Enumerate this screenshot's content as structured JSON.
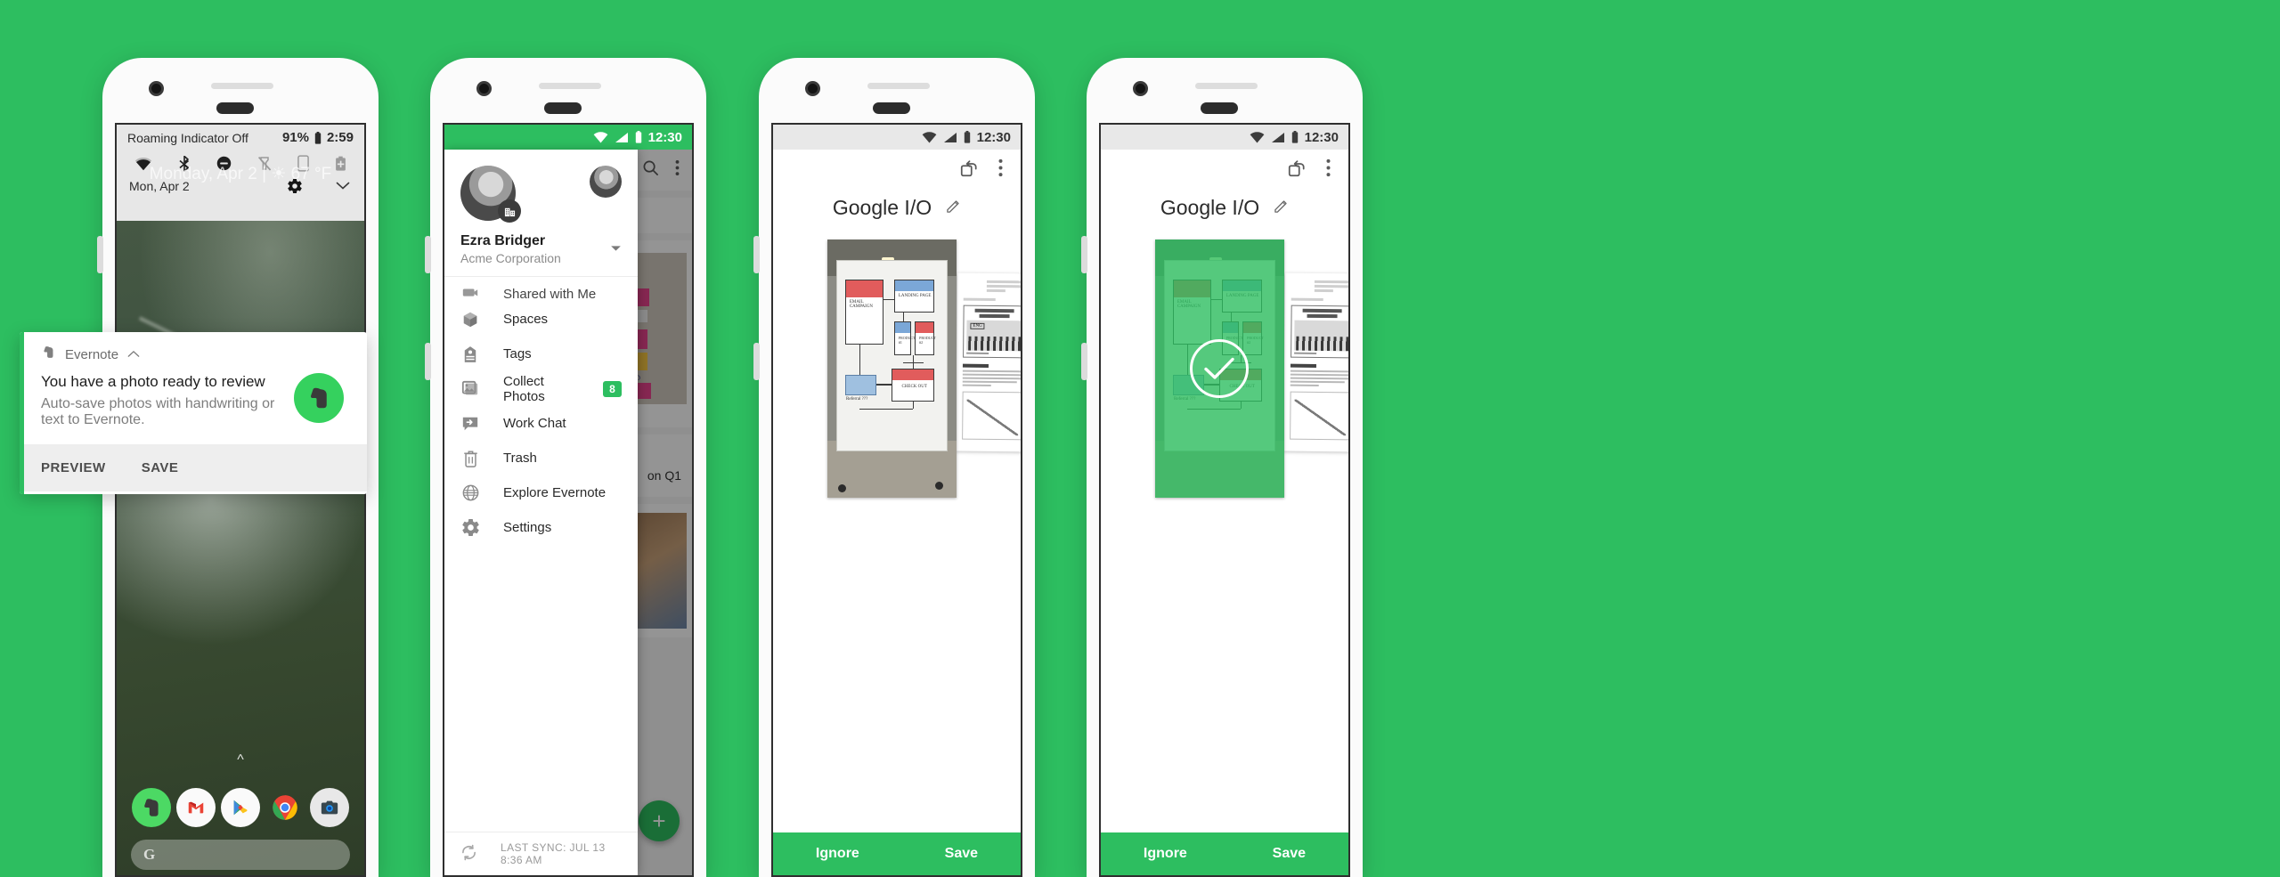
{
  "background_color": "#2DBE60",
  "brand_green": "#2DBE60",
  "phone1": {
    "name": "pixel-lockscreen-notification",
    "quick_settings": {
      "carrier_text": "Roaming Indicator Off",
      "battery_percent": "91%",
      "clock": "2:59",
      "date": "Mon, Apr 2",
      "toggles": [
        "wifi-icon",
        "bluetooth-icon",
        "do-not-disturb-icon",
        "flashlight-off-icon",
        "auto-rotate-icon",
        "battery-saver-icon"
      ],
      "settings_icon": "gear-icon",
      "expand_icon": "chevron-down-icon",
      "wallpaper_ghost_text": "Monday, Apr 2  |  ☀ 67 °F"
    },
    "notification": {
      "app_name": "Evernote",
      "collapse_icon": "chevron-up-icon",
      "title": "You have a photo ready to review",
      "body": "Auto-save photos with handwriting or text to Evernote.",
      "actions": [
        "PREVIEW",
        "SAVE"
      ],
      "badge_icon": "evernote-elephant-icon",
      "badge_color": "#35D15E"
    },
    "home_screen": {
      "dock_apps": [
        "evernote-icon",
        "gmail-icon",
        "play-store-icon",
        "chrome-icon",
        "camera-icon"
      ],
      "search_icon": "google-g-icon",
      "swipe_up_icon": "chevron-up-icon"
    }
  },
  "phone2": {
    "name": "evernote-navigation-drawer",
    "status_bar": {
      "clock": "12:30",
      "icons": [
        "wifi-icon",
        "signal-icon",
        "battery-icon"
      ]
    },
    "background_appbar": {
      "search_icon": "search-icon",
      "overflow_icon": "more-vertical-icon"
    },
    "background_note_text": "on Q1",
    "fab_icon": "plus-icon",
    "account": {
      "name": "Ezra Bridger",
      "org": "Acme Corporation",
      "avatar": "user-avatar",
      "org_badge_icon": "building-icon",
      "switch_account_avatar": "secondary-user-avatar",
      "dropdown_icon": "caret-down-icon"
    },
    "menu_items": [
      {
        "label": "Shared with Me",
        "icon": "shared-icon",
        "badge": ""
      },
      {
        "label": "Spaces",
        "icon": "cube-icon",
        "badge": ""
      },
      {
        "label": "Tags",
        "icon": "tag-icon",
        "badge": ""
      },
      {
        "label": "Collect Photos",
        "icon": "photos-icon",
        "badge": "8"
      },
      {
        "label": "Work Chat",
        "icon": "chat-icon",
        "badge": ""
      },
      {
        "label": "Trash",
        "icon": "trash-icon",
        "badge": ""
      },
      {
        "label": "Explore Evernote",
        "icon": "globe-icon",
        "badge": ""
      },
      {
        "label": "Settings",
        "icon": "gear-icon",
        "badge": ""
      }
    ],
    "sync_status": {
      "label": "LAST SYNC: JUL 13 8:36 AM",
      "icon": "sync-icon"
    }
  },
  "phone3": {
    "name": "photo-review-scan",
    "status_bar": {
      "clock": "12:30",
      "icons": [
        "wifi-icon",
        "signal-icon",
        "battery-icon"
      ]
    },
    "toolbar": {
      "rotate_icon": "rotate-icon",
      "overflow_icon": "more-vertical-icon"
    },
    "title": "Google I/O",
    "edit_icon": "pencil-icon",
    "whiteboard_labels": [
      "EMAIL CAMPAIGN",
      "LANDING PAGE",
      "PRODUCT #1",
      "PRODUCT #2",
      "CHECK OUT",
      "Referral ???"
    ],
    "footer": {
      "ignore_label": "Ignore",
      "save_label": "Save"
    }
  },
  "phone4": {
    "name": "photo-saved-confirmation",
    "status_bar": {
      "clock": "12:30",
      "icons": [
        "wifi-icon",
        "signal-icon",
        "battery-icon"
      ]
    },
    "toolbar": {
      "rotate_icon": "rotate-icon",
      "overflow_icon": "more-vertical-icon"
    },
    "title": "Google I/O",
    "edit_icon": "pencil-icon",
    "overlay": {
      "state_icon": "check-icon",
      "overlay_color": "#2DBE60"
    },
    "footer": {
      "ignore_label": "Ignore",
      "save_label": "Save"
    }
  }
}
